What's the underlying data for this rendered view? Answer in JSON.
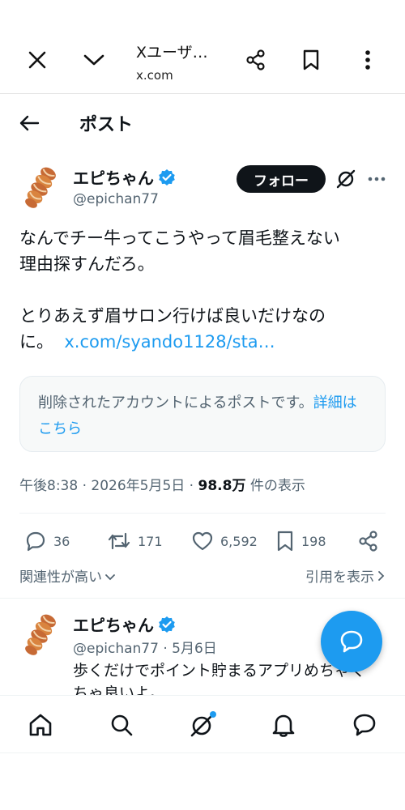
{
  "browser": {
    "title": "Xユーザー…",
    "title_visible": "Xユーザ…",
    "url": "x.com",
    "icons": [
      "close-icon",
      "chevron-down-icon",
      "share-icon",
      "bookmark-icon",
      "more-vertical-icon"
    ]
  },
  "header": {
    "title": "ポスト",
    "back_icon": "arrow-left-icon"
  },
  "post": {
    "author": {
      "name": "エピちゃん",
      "handle": "@epichan77",
      "verified": true,
      "avatar": "twisted-bread-avatar"
    },
    "follow_label": "フォロー",
    "text_line1": "なんでチー牛ってこうやって眉毛整えない",
    "text_line2": "理由探すんだろ。",
    "text_line3": "とりあえず眉サロン行けば良いだけなの",
    "text_line4_prefix": "に。",
    "text_link": "x.com/syando1128/sta…",
    "notice_text": "削除されたアカウントによるポストです。",
    "notice_link": "詳細はこちら",
    "timestamp": "午後8:38 · 2026年5月5日 · ",
    "views_count": "98.8万",
    "views_label": " 件の表示",
    "replies": "36",
    "reposts": "171",
    "likes": "6,592",
    "bookmarks": "198"
  },
  "sort": {
    "left": "関連性が高い",
    "right": "引用を表示"
  },
  "reply": {
    "author": {
      "name": "エピちゃん",
      "handle": "@epichan77",
      "date": "· 5月6日",
      "verified": true
    },
    "text_line1": "歩くだけでポイント貯まるアプリめちゃく",
    "text_line2": "ちゃ良いよ。"
  },
  "bottom_nav": {
    "items": [
      "home-icon",
      "search-icon",
      "grok-icon",
      "notifications-icon",
      "messages-icon"
    ],
    "badge_color": "#1d9bf0"
  },
  "colors": {
    "accent": "#1d9bf0",
    "text": "#0f1419",
    "secondary": "#536471"
  }
}
